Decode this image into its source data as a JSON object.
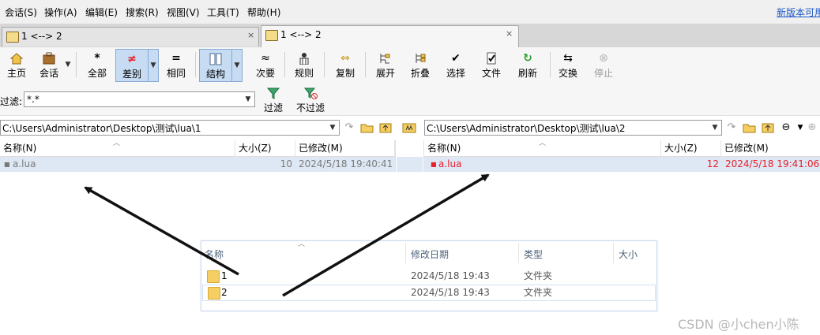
{
  "menu": [
    "会话(S)",
    "操作(A)",
    "编辑(E)",
    "搜索(R)",
    "视图(V)",
    "工具(T)",
    "帮助(H)"
  ],
  "new_version_link": "新版本可用",
  "tabs": [
    {
      "label": "1 <--> 2",
      "active": false
    },
    {
      "label": "1 <--> 2",
      "active": true
    }
  ],
  "tab_close_glyph": "×",
  "toolbar": {
    "home": "主页",
    "session": "会话",
    "all": "全部",
    "diff": "差别",
    "same": "相同",
    "structure": "结构",
    "minor": "次要",
    "rules": "规则",
    "copy": "复制",
    "expand": "展开",
    "collapse": "折叠",
    "select": "选择",
    "files": "文件",
    "refresh": "刷新",
    "swap": "交换",
    "stop": "停止"
  },
  "filter": {
    "label": "过滤:",
    "value": "*.*",
    "filter_button": "过滤",
    "no_filter_button": "不过滤"
  },
  "left_pane": {
    "path": "C:\\Users\\Administrator\\Desktop\\测试\\lua\\1",
    "columns": [
      "名称(N)",
      "大小(Z)",
      "已修改(M)"
    ],
    "rows": [
      {
        "name": "a.lua",
        "size": "10",
        "modified": "2024/5/18 19:40:41"
      }
    ]
  },
  "right_pane": {
    "path": "C:\\Users\\Administrator\\Desktop\\测试\\lua\\2",
    "columns": [
      "名称(N)",
      "大小(Z)",
      "已修改(M)"
    ],
    "rows": [
      {
        "name": "a.lua",
        "size": "12",
        "modified": "2024/5/18 19:41:06"
      }
    ]
  },
  "explorer": {
    "columns": [
      "名称",
      "修改日期",
      "类型",
      "大小"
    ],
    "rows": [
      {
        "name": "1",
        "modified": "2024/5/18 19:43",
        "type": "文件夹"
      },
      {
        "name": "2",
        "modified": "2024/5/18 19:43",
        "type": "文件夹"
      }
    ]
  },
  "colors": {
    "diff_red": "#e8202a",
    "row_highlight": "#dde8f4",
    "link_blue": "#1f57c7",
    "arrow": "#111111"
  },
  "watermark": "CSDN @小chen小陈"
}
